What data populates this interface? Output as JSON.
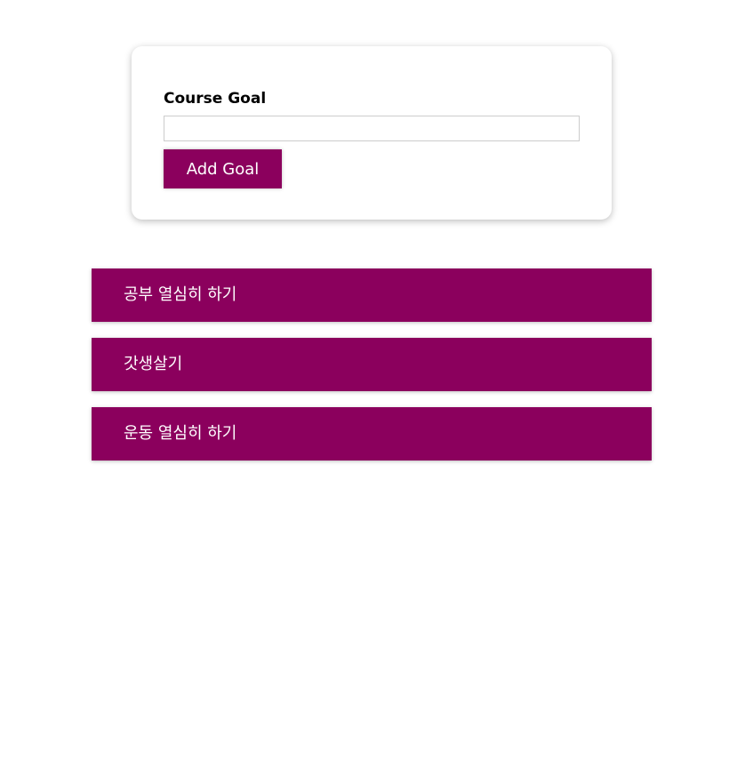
{
  "form": {
    "label": "Course Goal",
    "input_value": "",
    "button_label": "Add Goal"
  },
  "goals": [
    {
      "text": "공부 열심히 하기"
    },
    {
      "text": "갓생살기"
    },
    {
      "text": "운동 열심히 하기"
    }
  ],
  "colors": {
    "accent": "#8b005d",
    "input_border": "#cccccc",
    "background": "#ffffff"
  }
}
